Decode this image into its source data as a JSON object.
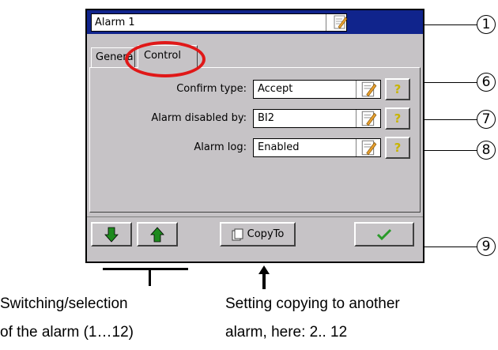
{
  "dialog": {
    "title": "Alarm 1",
    "tabs": [
      {
        "label": "General",
        "active": false
      },
      {
        "label": "Control",
        "active": true
      }
    ],
    "rows": [
      {
        "label": "Confirm type:",
        "value": "Accept"
      },
      {
        "label": "Alarm disabled by:",
        "value": "BI2"
      },
      {
        "label": "Alarm log:",
        "value": "Enabled"
      }
    ],
    "toolbar": {
      "copy_label": "CopyTo"
    }
  },
  "callouts": [
    "1",
    "6",
    "7",
    "8",
    "9"
  ],
  "captions": {
    "left_line1": "Switching/selection",
    "left_line2": "of the alarm (1…12)",
    "right_line1": "Setting copying to another",
    "right_line2": "alarm, here: 2.. 12"
  },
  "colors": {
    "title_bar": "#10248c",
    "panel": "#c6c3c6",
    "highlight": "#e01818",
    "arrow_green": "#1e8a1e"
  }
}
